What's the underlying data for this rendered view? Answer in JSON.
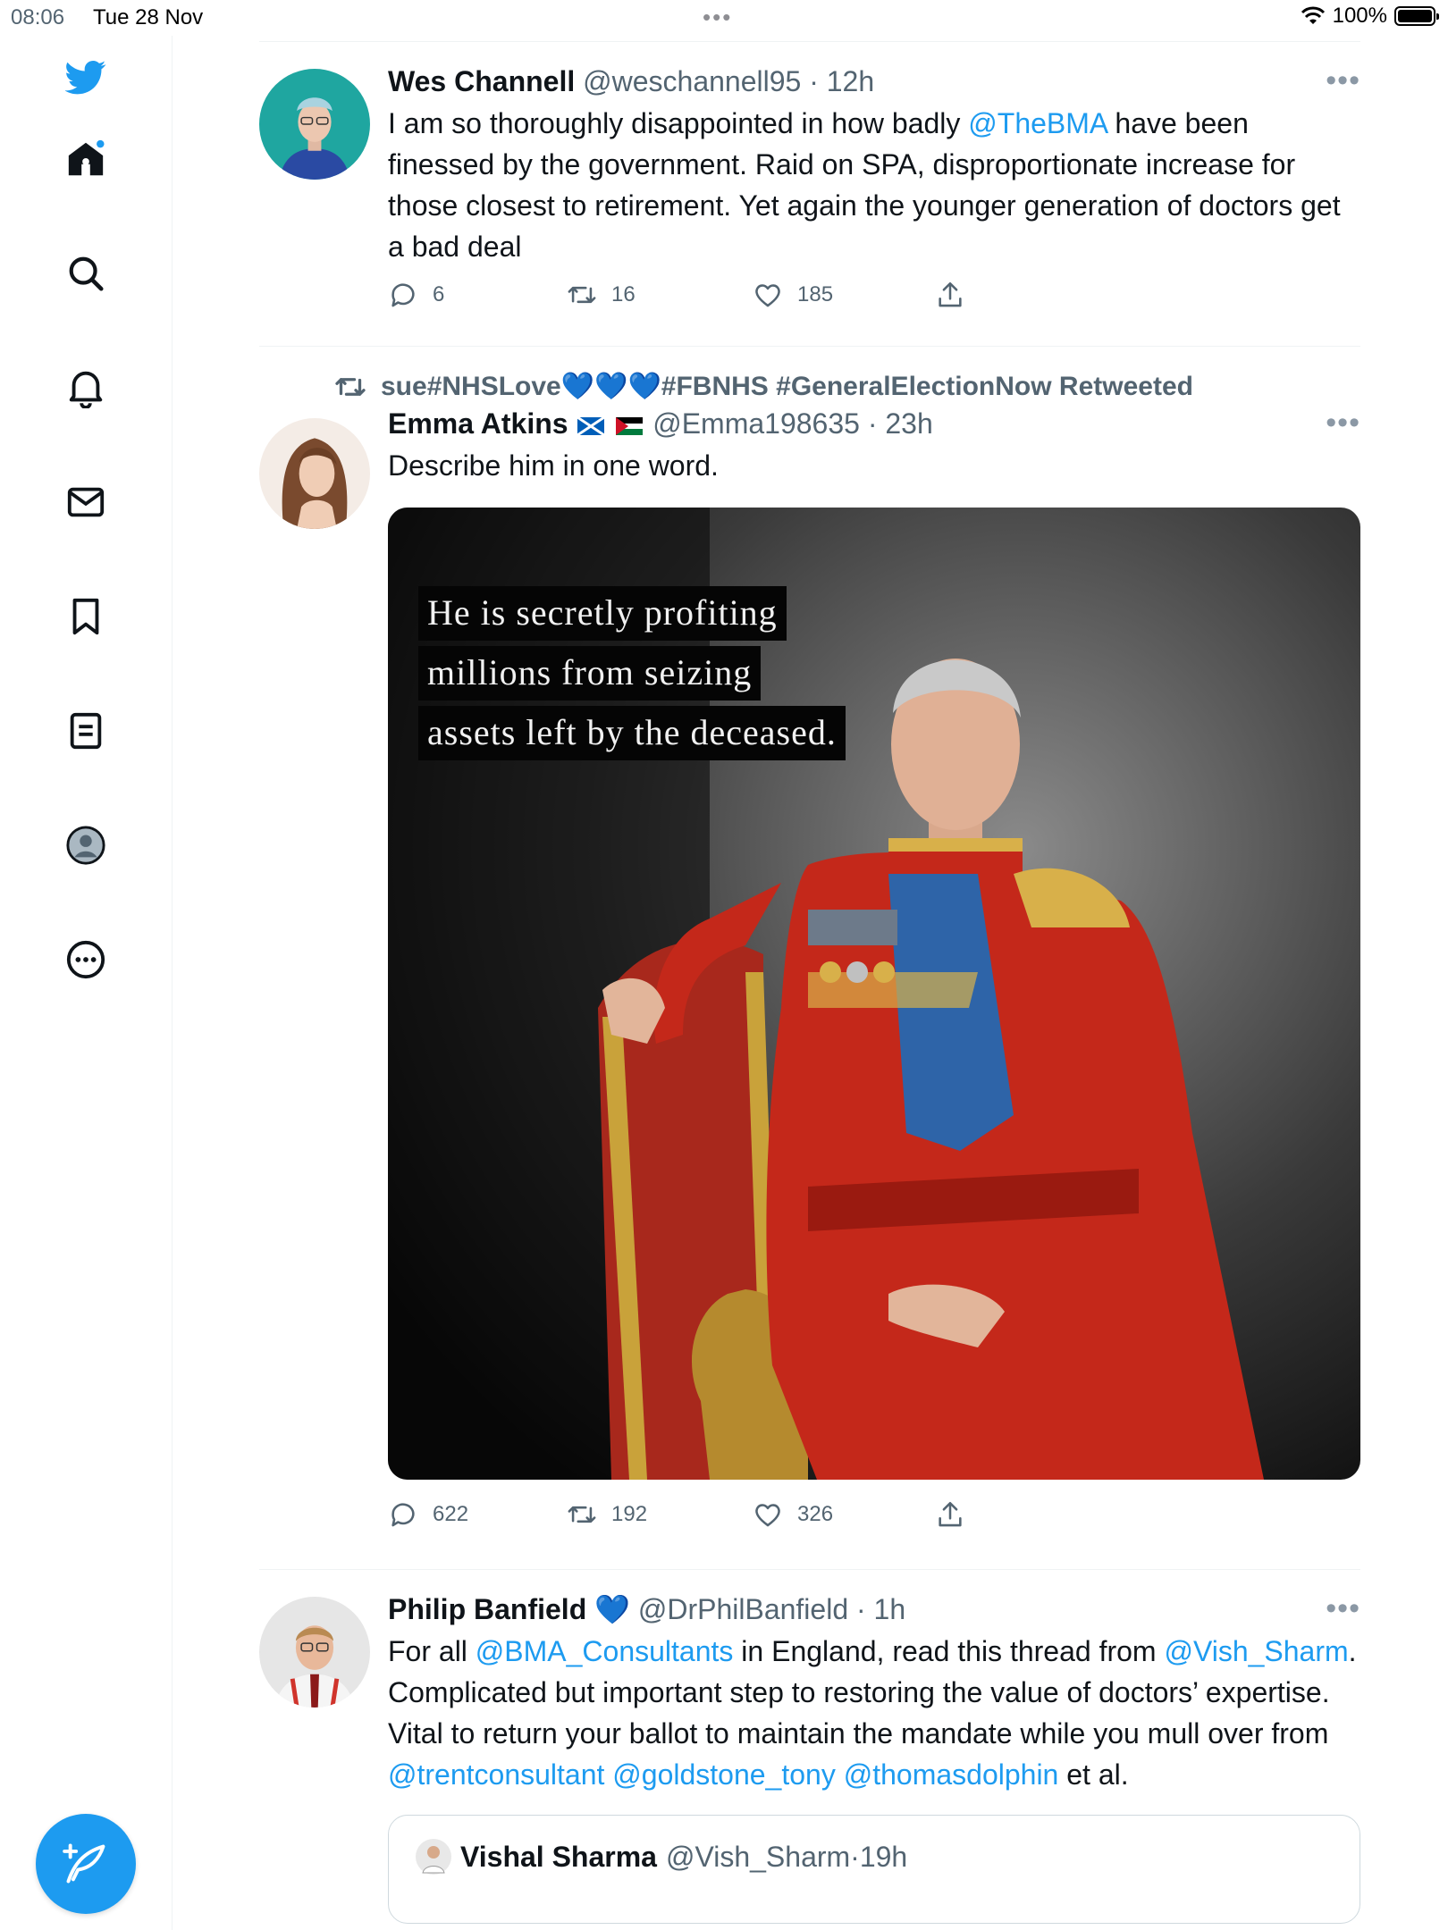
{
  "status_bar": {
    "time": "08:06",
    "date": "Tue 28 Nov",
    "battery": "100%"
  },
  "nav": {
    "icons": [
      "twitter-logo-icon",
      "home-icon",
      "search-icon",
      "notifications-icon",
      "messages-icon",
      "bookmarks-icon",
      "lists-icon",
      "profile-icon",
      "more-icon",
      "compose-icon"
    ],
    "accent": "#1d9bf0"
  },
  "tweets": [
    {
      "name": "Wes Channell",
      "handle": "@weschannell95",
      "time": "12h",
      "text_before": "I am so thoroughly disappointed in how badly ",
      "mention": "@TheBMA",
      "text_after": " have been finessed by the government. Raid on SPA, disproportionate increase for those closest to retirement. Yet again the younger generation of doctors get a bad deal",
      "replies": "6",
      "retweets": "16",
      "likes": "185"
    },
    {
      "retweeted_by": "sue#NHSLove💙💙💙#FBNHS #GeneralElectionNow Retweeted",
      "name": "Emma Atkins",
      "handle": "@Emma198635",
      "time": "23h",
      "text": "Describe him in one word.",
      "image_caption": [
        "He is secretly profiting",
        "millions from seizing",
        "assets left by the deceased."
      ],
      "replies": "622",
      "retweets": "192",
      "likes": "326"
    },
    {
      "name": "Philip Banfield",
      "verified": "💙",
      "handle": "@DrPhilBanfield",
      "time": "1h",
      "t1": "For all ",
      "m1": "@BMA_Consultants",
      "t2": " in England, read this thread from ",
      "m2": "@Vish_Sharm",
      "t3": ". Complicated but important step to restoring the value of doctors’ expertise. Vital to return your ballot to maintain the mandate while you mull over from ",
      "m3": "@trentconsultant",
      "m4": "@goldstone_tony",
      "m5": "@thomasdolphin",
      "t4": " et al.",
      "quote": {
        "name": "Vishal Sharma",
        "handle": "@Vish_Sharm",
        "time": "19h"
      }
    }
  ]
}
